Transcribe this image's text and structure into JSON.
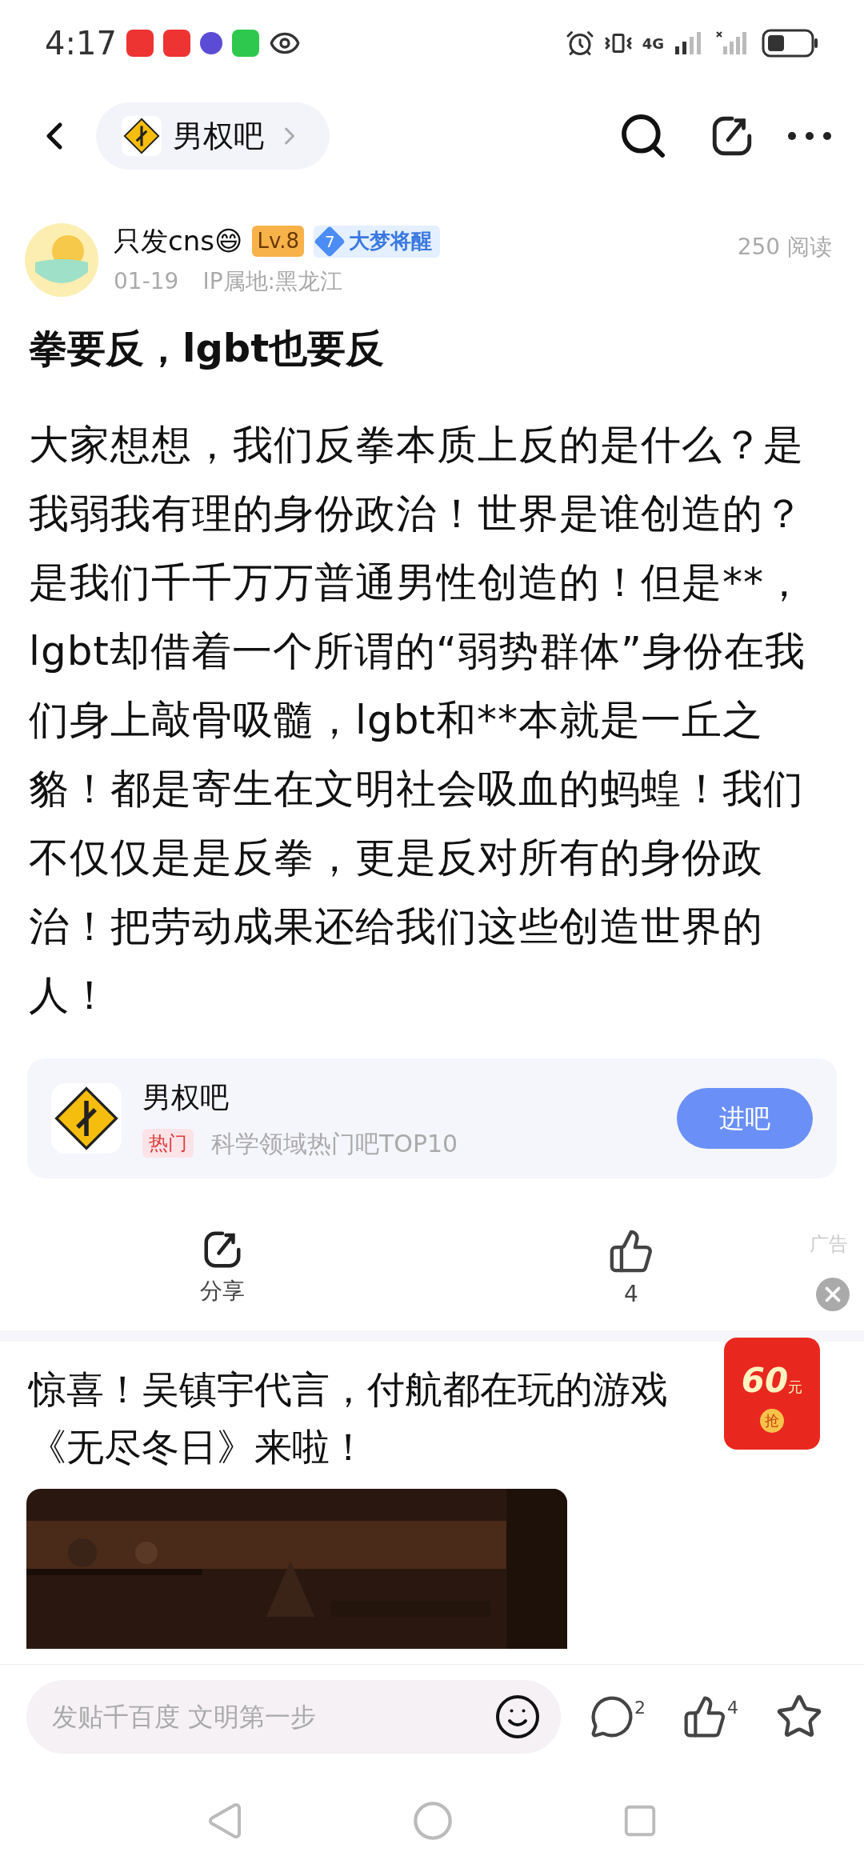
{
  "status_bar": {
    "time": "4:17",
    "network": "4G"
  },
  "nav": {
    "forum_name": "男权吧"
  },
  "post": {
    "author": "只发cns😄",
    "level": "Lv.8",
    "badge_number": "7",
    "badge_title": "大梦将醒",
    "date": "01-19",
    "ip": "IP属地:黑龙江",
    "reads": "250 阅读",
    "title": "拳要反，lgbt也要反",
    "body": "大家想想，我们反拳本质上反的是什么？是我弱我有理的身份政治！世界是谁创造的？是我们千千万万普通男性创造的！但是**，lgbt却借着一个所谓的“弱势群体”身份在我们身上敲骨吸髓，lgbt和**本就是一丘之貉！都是寄生在文明社会吸血的蚂蝗！我们不仅仅是是反拳，更是反对所有的身份政治！把劳动成果还给我们这些创造世界的人！"
  },
  "forum_card": {
    "name": "男权吧",
    "tag": "热门",
    "subtitle": "科学领域热门吧TOP10",
    "button": "进吧"
  },
  "actions": {
    "share": "分享",
    "likes": "4"
  },
  "ad": {
    "label": "广告",
    "title": "惊喜！吴镇宇代言，付航都在玩的游戏《无尽冬日》来啦！",
    "red_packet_amount": "60",
    "red_packet_unit": "元",
    "red_packet_action": "抢"
  },
  "bottom_bar": {
    "placeholder": "发贴千百度 文明第一步",
    "comments": "2",
    "likes": "4"
  }
}
